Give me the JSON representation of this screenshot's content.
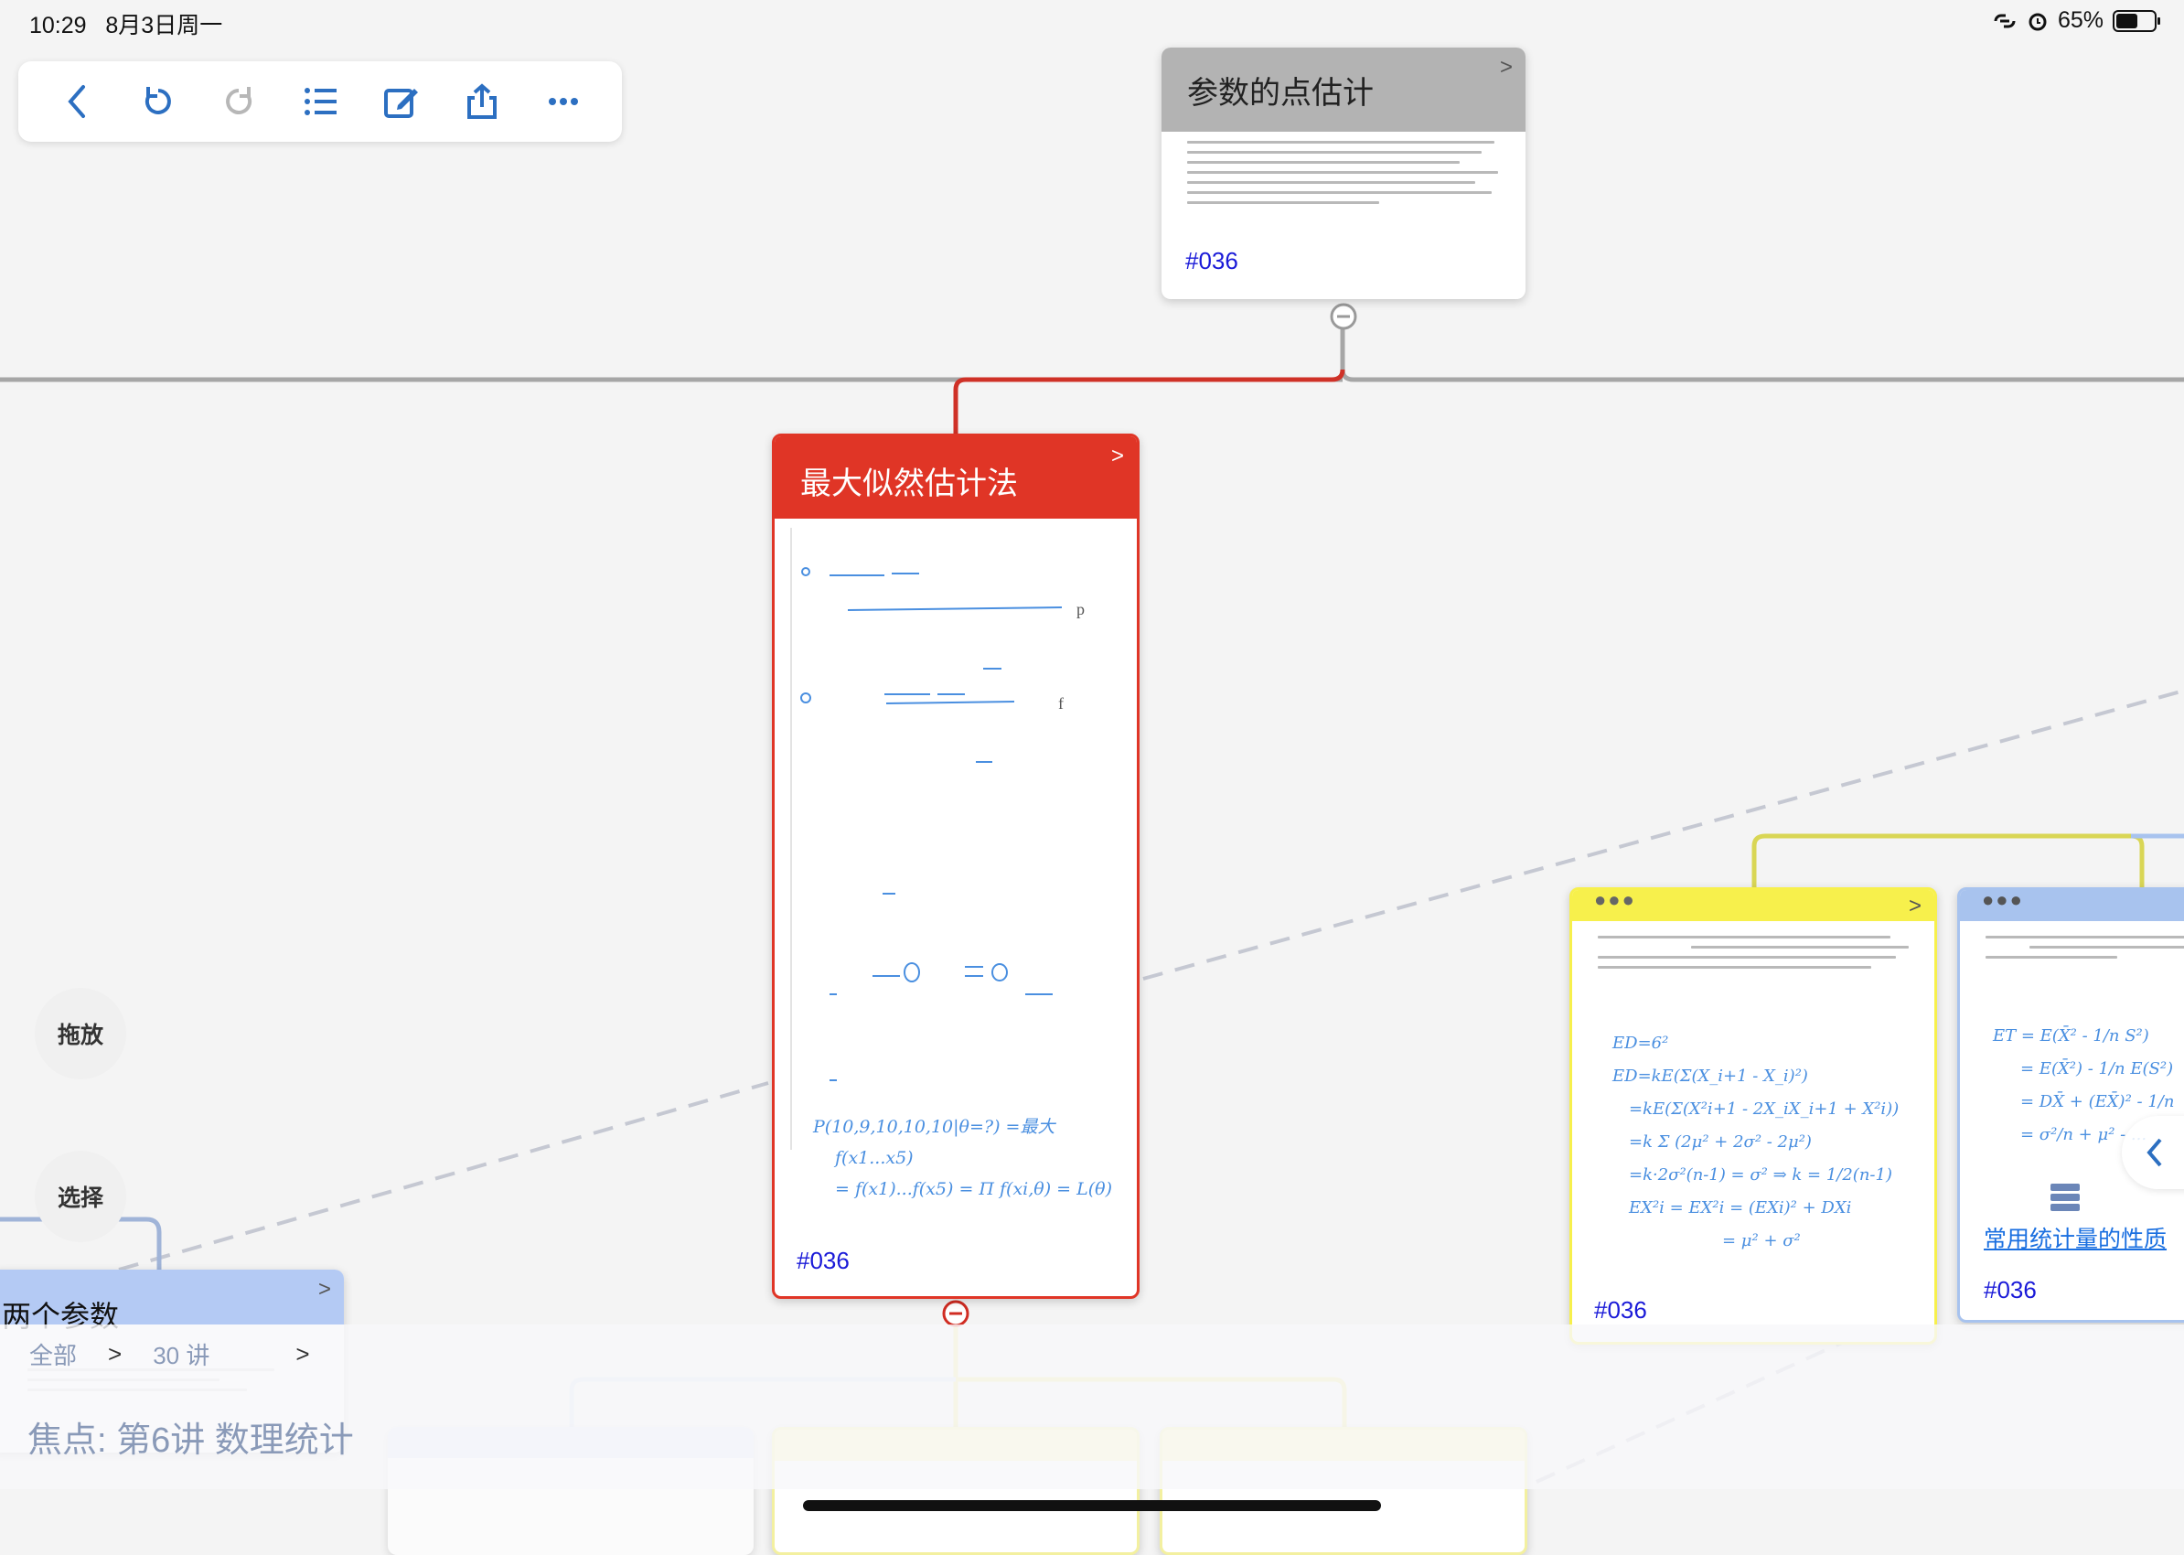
{
  "status_bar": {
    "time": "10:29",
    "date": "8月3日周一",
    "battery": "65%",
    "battery_level": 0.65
  },
  "toolbar": {
    "items": [
      {
        "name": "back-icon"
      },
      {
        "name": "undo-icon"
      },
      {
        "name": "redo-icon"
      },
      {
        "name": "list-icon"
      },
      {
        "name": "edit-icon"
      },
      {
        "name": "share-icon"
      },
      {
        "name": "more-icon"
      }
    ]
  },
  "cards": {
    "top": {
      "title": "参数的点估计",
      "tag": "#036",
      "header_color": "#b3b3b3"
    },
    "center": {
      "title": "最大似然估计法",
      "tag": "#036",
      "header_color": "#e03526"
    },
    "yellow": {
      "tag": "#036",
      "header_color": "#f7f04c",
      "handwriting": [
        "ED=6²",
        "ED=kE(Σ(X_i+1 - X_i)²)",
        "=kE(Σ(X²i+1 - 2X_iX_i+1 + X²i))",
        "=k Σ (2μ² + 2σ² - 2μ²)",
        "=k·2σ²(n-1) = σ² ⇒ k = 1/2(n-1)",
        "EX²i = EX²i = (EXi)² + DXi",
        "= μ² + σ²"
      ]
    },
    "blue": {
      "tag": "#036",
      "link_text": "常用统计量的性质",
      "header_color": "#a8c3ee",
      "handwriting": [
        "ET = E(X̄² - 1/n S²)",
        "= E(X̄²) - 1/n E(S²)",
        "= DX̄ + (EX̄)² - 1/n",
        "= σ²/n + μ² - ..."
      ]
    },
    "left": {
      "title": "两个参数",
      "header_color": "#b4caf4"
    }
  },
  "center_card_formulas": [
    "P(10,9,10,10,10|θ=?) =最大",
    "f(x1...x5)",
    "= f(x1)...f(x5) = Π f(xi,θ) = L(θ)"
  ],
  "center_card_marks": [
    "p",
    "f"
  ],
  "side_buttons": {
    "drag": "拖放",
    "select": "选择"
  },
  "breadcrumb": {
    "all": "全部",
    "sep": ">",
    "lecture": "30 讲"
  },
  "focus": {
    "text": "焦点:  第6讲 数理统计"
  }
}
